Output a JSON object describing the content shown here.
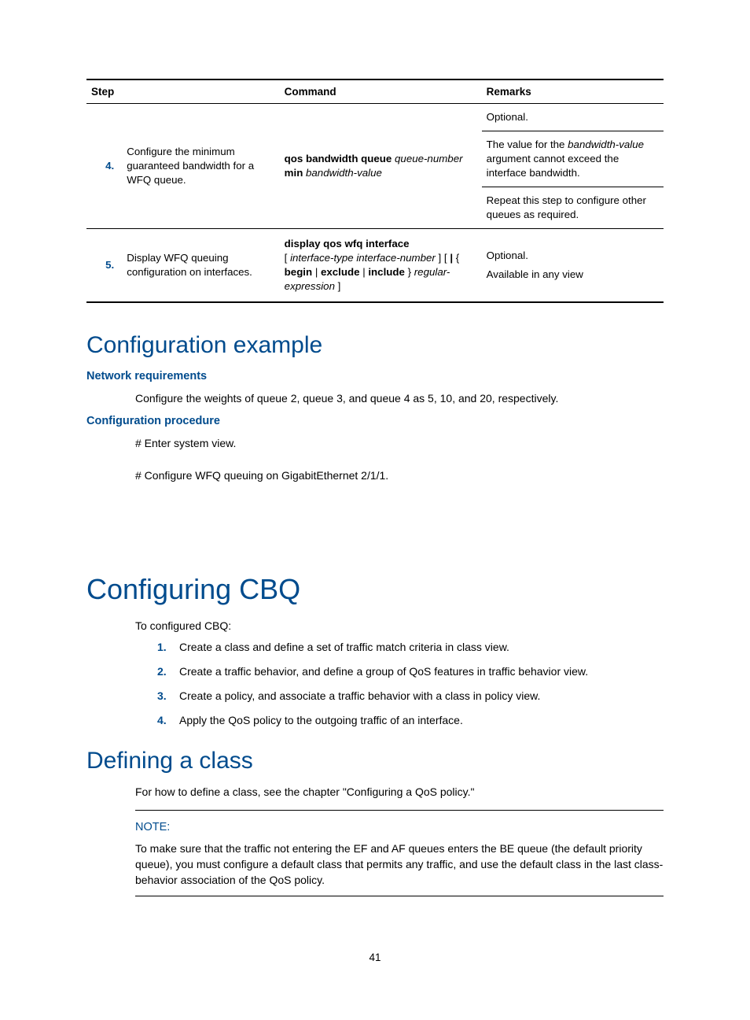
{
  "table": {
    "headers": [
      "Step",
      "Command",
      "Remarks"
    ],
    "rows": [
      {
        "num": "4.",
        "step": "Configure the minimum guaranteed bandwidth for a WFQ queue.",
        "command_parts": [
          {
            "text": "qos bandwidth queue ",
            "b": true
          },
          {
            "text": "queue-number",
            "i": true
          },
          {
            "text": " "
          },
          {
            "text": "min ",
            "b": true
          },
          {
            "text": "bandwidth-value",
            "i": true
          }
        ],
        "remarks": [
          "Optional.",
          {
            "parts": [
              {
                "text": "The value for the "
              },
              {
                "text": "bandwidth-value",
                "i": true
              },
              {
                "text": " argument cannot exceed the interface bandwidth."
              }
            ]
          },
          "Repeat this step to configure other queues as required."
        ]
      },
      {
        "num": "5.",
        "step": "Display WFQ queuing configuration on interfaces.",
        "command_parts": [
          {
            "text": "display qos wfq interface",
            "b": true
          },
          {
            "text": "\n"
          },
          {
            "text": "[ "
          },
          {
            "text": "interface-type interface-number",
            "i": true
          },
          {
            "text": " ] [ "
          },
          {
            "text": "|",
            "b": true
          },
          {
            "text": " { "
          },
          {
            "text": "begin",
            "b": true
          },
          {
            "text": " | "
          },
          {
            "text": "exclude",
            "b": true
          },
          {
            "text": " | "
          },
          {
            "text": "include",
            "b": true
          },
          {
            "text": " } "
          },
          {
            "text": "regular-expression",
            "i": true
          },
          {
            "text": " ]"
          }
        ],
        "remarks": [
          "Optional.",
          "Available in any view"
        ]
      }
    ]
  },
  "h_config_example": "Configuration example",
  "h_net_req": "Network requirements",
  "net_req_body": "Configure the weights of queue 2, queue 3, and queue 4 as 5, 10, and 20, respectively.",
  "h_config_proc": "Configuration procedure",
  "proc_line_1": "# Enter system view.",
  "proc_line_2": "# Configure WFQ queuing on GigabitEthernet 2/1/1.",
  "h_configuring_cbq": "Configuring CBQ",
  "cbq_intro": "To configured CBQ:",
  "cbq_steps": [
    "Create a class and define a set of traffic match criteria in class view.",
    "Create a traffic behavior, and define a group of QoS features in traffic behavior view.",
    "Create a policy, and associate a traffic behavior with a class in policy view.",
    "Apply the QoS policy to the outgoing traffic of an interface."
  ],
  "h_defining_class": "Defining a class",
  "defining_body": "For how to define a class, see the chapter \"Configuring a QoS policy.\"",
  "note_label": "NOTE:",
  "note_body": "To make sure that the traffic not entering the EF and AF queues enters the BE queue (the default priority queue), you must configure a default class that permits any traffic, and use the default class in the last class-behavior association of the QoS policy.",
  "page_number": "41"
}
